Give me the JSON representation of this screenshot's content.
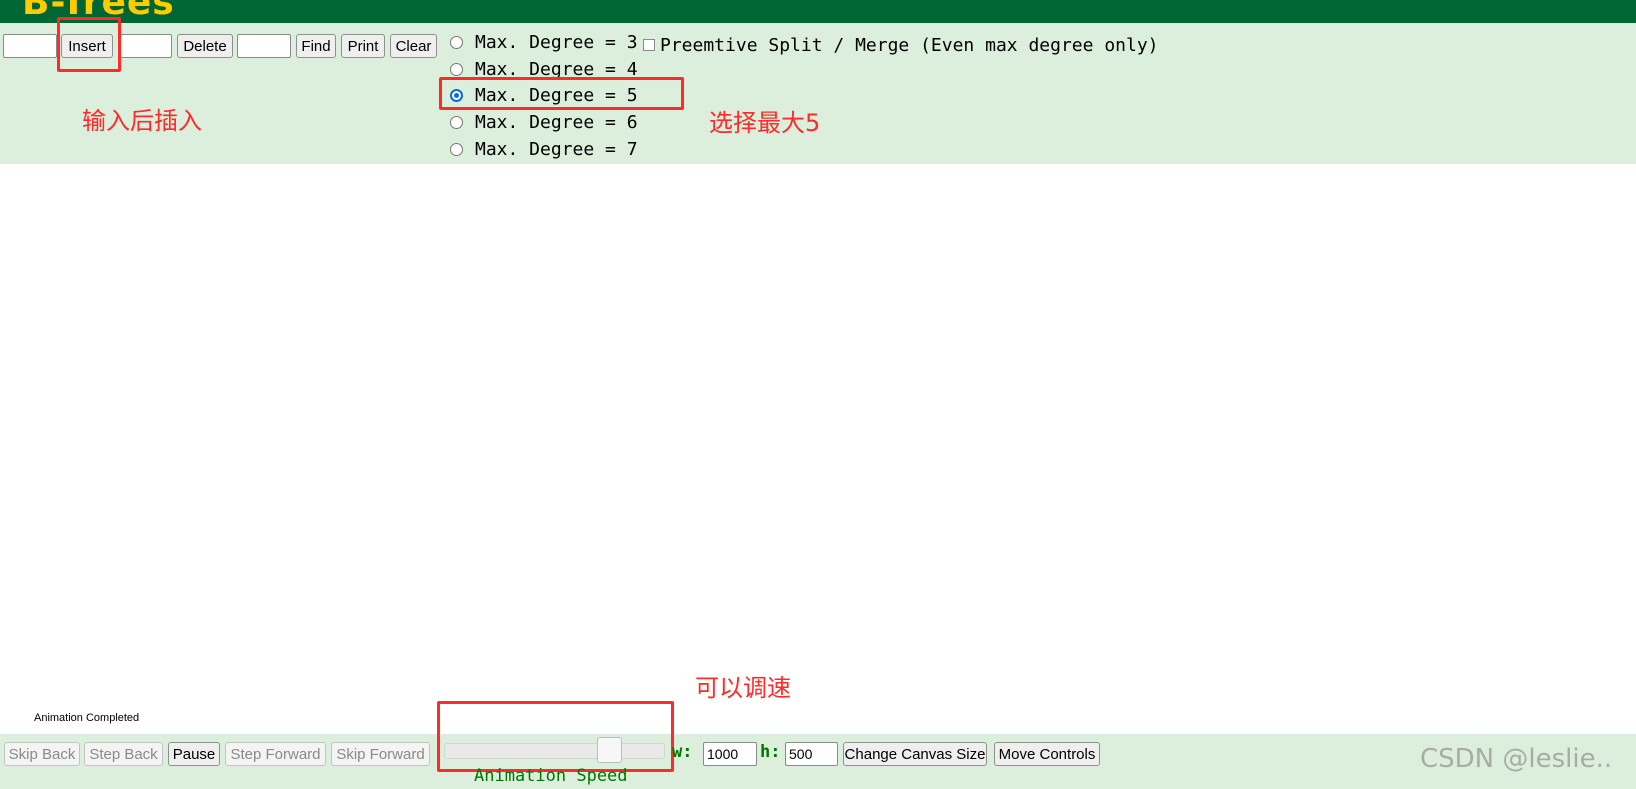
{
  "header": {
    "title": "B-Trees"
  },
  "toolbar": {
    "insert_value": "",
    "insert_label": "Insert",
    "delete_value": "",
    "delete_label": "Delete",
    "find_value": "",
    "find_label": "Find",
    "print_label": "Print",
    "clear_label": "Clear"
  },
  "degree_options": {
    "selected": "Max. Degree = 5",
    "items": [
      "Max. Degree = 3",
      "Max. Degree = 4",
      "Max. Degree = 5",
      "Max. Degree = 6",
      "Max. Degree = 7"
    ]
  },
  "preemptive": {
    "label": "Preemtive Split / Merge (Even max degree only)",
    "checked": false
  },
  "annotations": {
    "insert_note": "输入后插入",
    "degree_note": "选择最大5",
    "speed_note": "可以调速"
  },
  "status": {
    "text": "Animation Completed"
  },
  "controls": {
    "skip_back": "Skip Back",
    "step_back": "Step Back",
    "pause": "Pause",
    "step_forward": "Step Forward",
    "skip_forward": "Skip Forward",
    "speed_label": "Animation Speed",
    "speed_fraction": 0.78,
    "width_label": "w:",
    "width_value": "1000",
    "height_label": "h:",
    "height_value": "500",
    "change_canvas": "Change Canvas Size",
    "move_controls": "Move Controls"
  },
  "watermark": {
    "text": "CSDN @leslie.."
  },
  "colors": {
    "header_bg": "#006633",
    "title": "#ffcc00",
    "panel_bg": "#dcefdc",
    "annotation": "#ff2a2a",
    "label_green": "#007700",
    "radio_selected": "#0b6bdc"
  }
}
